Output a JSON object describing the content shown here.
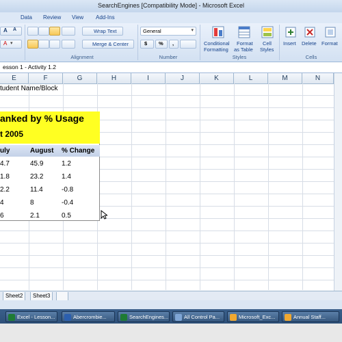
{
  "window": {
    "title": "SearchEngines  [Compatibility Mode] - Microsoft Excel"
  },
  "menu": {
    "tabs": [
      "Data",
      "Review",
      "View",
      "Add-Ins"
    ]
  },
  "ribbon": {
    "wrap_text": "Wrap Text",
    "merge_center": "Merge & Center",
    "number_format": "General",
    "currency": "$",
    "percent": "%",
    "comma": ",",
    "conditional_formatting": [
      "Conditional",
      "Formatting"
    ],
    "format_as_table": [
      "Format",
      "as Table"
    ],
    "cell_styles": [
      "Cell",
      "Styles"
    ],
    "insert": "Insert",
    "delete": "Delete",
    "format": "Format",
    "groups": {
      "alignment": "Alignment",
      "number": "Number",
      "styles": "Styles",
      "cells": "Cells"
    }
  },
  "formula_bar": {
    "content": "esson 1 - Activity 1.2"
  },
  "columns": [
    "E",
    "F",
    "G",
    "H",
    "I",
    "J",
    "K",
    "L",
    "M",
    "N"
  ],
  "sheet": {
    "student_label": "tudent Name/Block",
    "table_title_line1": "anked by % Usage",
    "table_title_line2": "t 2005",
    "headers": [
      "uly",
      "August",
      "% Change"
    ],
    "rows": [
      [
        "4.7",
        "45.9",
        "1.2"
      ],
      [
        "1.8",
        "23.2",
        "1.4"
      ],
      [
        "2.2",
        "11.4",
        "-0.8"
      ],
      [
        "4",
        "8",
        "-0.4"
      ],
      [
        "6",
        "2.1",
        "0.5"
      ]
    ]
  },
  "sheet_tabs": [
    "Sheet2",
    "Sheet3"
  ],
  "taskbar": {
    "items": [
      "Excel - Lesson...",
      "Abercrombie...",
      "SearchEngines...",
      "All Control Pa...",
      "Microsoft_Exc...",
      "Annual Staff..."
    ]
  },
  "colors": {
    "title_fill": "#ffff22",
    "header_fill": "#c3d1e8",
    "ribbon_blue": "#15428b"
  }
}
